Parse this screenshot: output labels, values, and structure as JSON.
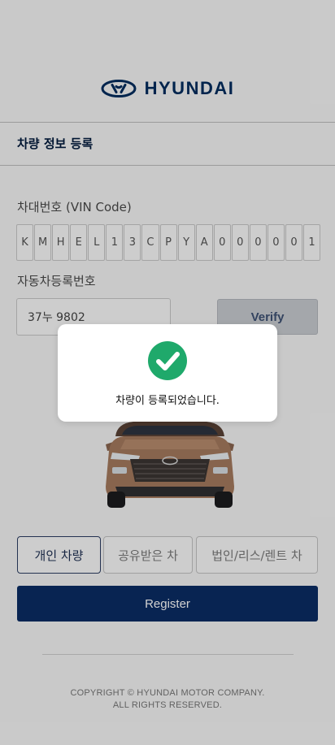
{
  "brand": {
    "wordmark": "HYUNDAI",
    "logo_icon": "hyundai-logo-icon",
    "color": "#002c5f"
  },
  "page": {
    "title": "차량 정보 등록"
  },
  "vin": {
    "label": "차대번호 (VIN Code)",
    "chars": [
      "K",
      "M",
      "H",
      "E",
      "L",
      "1",
      "3",
      "C",
      "P",
      "Y",
      "A",
      "0",
      "0",
      "0",
      "0",
      "0",
      "1"
    ]
  },
  "plate": {
    "label": "자동차등록번호",
    "value": "37누 9802",
    "verify_label": "Verify"
  },
  "vehicle_types": {
    "options": [
      "개인 차량",
      "공유받은 차",
      "법인/리스/렌트 차"
    ],
    "selected": "개인 차량"
  },
  "register_label": "Register",
  "footer": {
    "line1": "COPYRIGHT © HYUNDAI MOTOR COMPANY.",
    "line2": "ALL RIGHTS RESERVED."
  },
  "dialog": {
    "icon": "check-circle-icon",
    "message": "차량이 등록되었습니다."
  },
  "colors": {
    "primary": "#0a2c64",
    "success": "#1fa96b",
    "overlay": "rgba(0,0,0,0.18)"
  }
}
